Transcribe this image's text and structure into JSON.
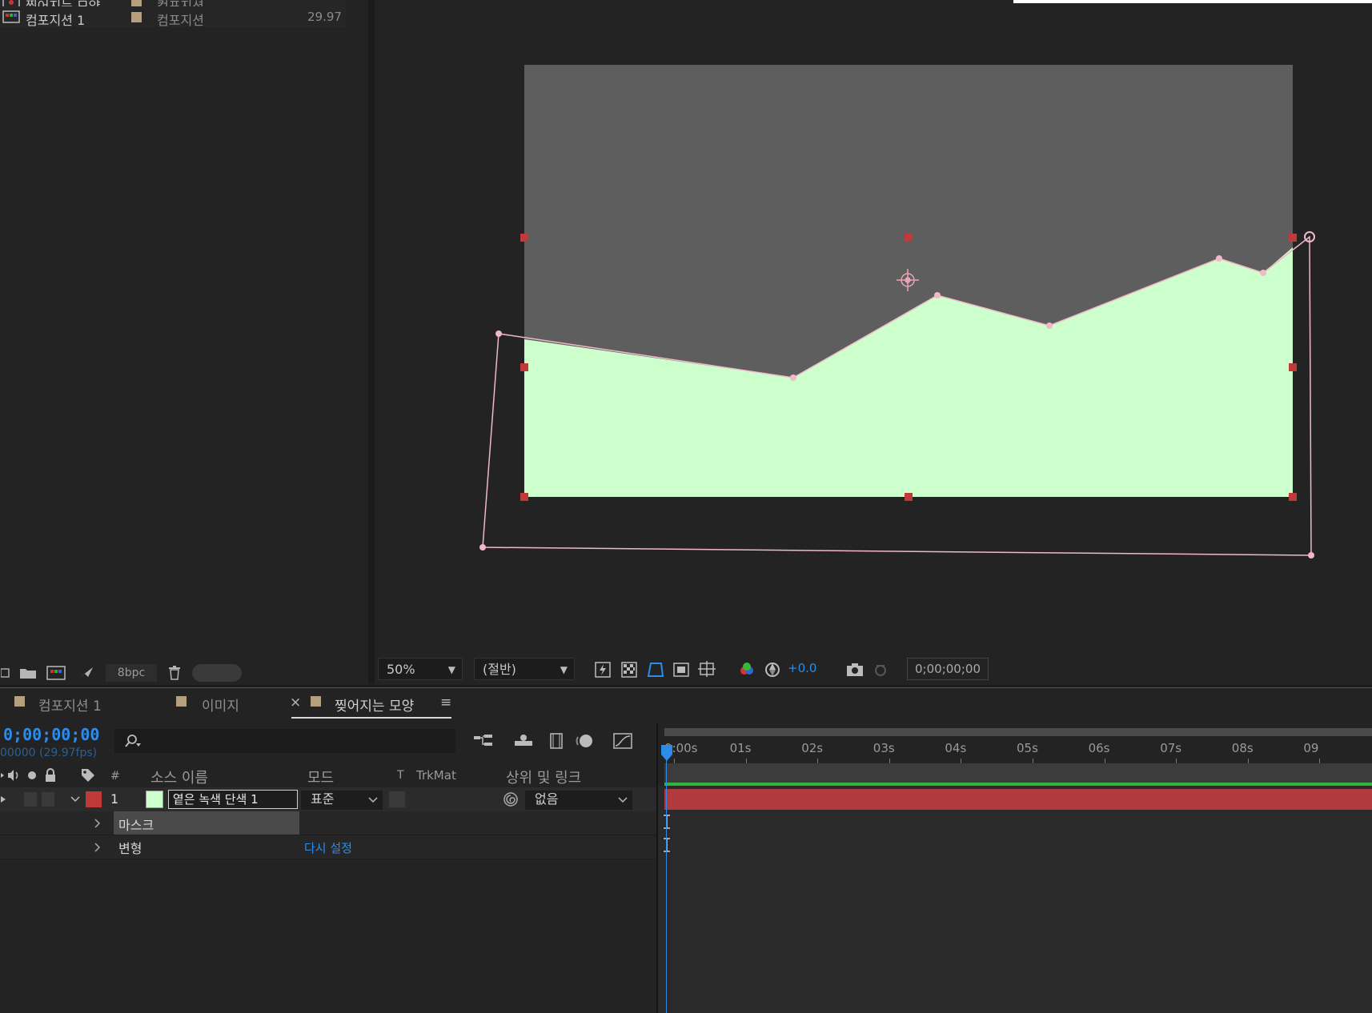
{
  "project": {
    "rows": [
      {
        "name": "찢어지는 모양",
        "type": "컴포지션",
        "fps": ""
      },
      {
        "name": "컴포지션 1",
        "type": "컴포지션",
        "fps": "29.97"
      }
    ],
    "bpc": "8bpc"
  },
  "viewer": {
    "layer_color": "#ccffcc",
    "comp_bg_color": "#5e5e5e",
    "mask_color": "#f0b8c8"
  },
  "viewer_footer": {
    "zoom": "50%",
    "resolution": "(절반)",
    "exposure": "+0.0",
    "timecode": "0;00;00;00"
  },
  "timeline": {
    "tabs": [
      {
        "label": "컴포지션 1",
        "closable": false,
        "active": false
      },
      {
        "label": "이미지",
        "closable": false,
        "active": false
      },
      {
        "label": "찢어지는 모양",
        "closable": true,
        "active": true
      }
    ],
    "close_glyph": "×",
    "menu_glyph": "≡",
    "timecode": "0;00;00;00",
    "frame_info": "00000 (29.97fps)",
    "columns": {
      "number": "#",
      "source_name": "소스 이름",
      "mode": "모드",
      "t": "T",
      "trkmat": "TrkMat",
      "parent": "상위 및 링크"
    },
    "layer": {
      "index": "1",
      "label_color": "#c03a3a",
      "swatch_color": "#ccffcc",
      "name": "옅은 녹색 단색 1",
      "mode": "표준",
      "parent": "없음"
    },
    "properties": [
      {
        "label": "마스크",
        "value": ""
      },
      {
        "label": "변형",
        "value": "다시 설정"
      }
    ],
    "ruler_labels": [
      "0:00s",
      "01s",
      "02s",
      "03s",
      "04s",
      "05s",
      "06s",
      "07s",
      "08s",
      "09"
    ],
    "accent_color": "#2d8ceb",
    "bar_color": "#b13a3e"
  }
}
